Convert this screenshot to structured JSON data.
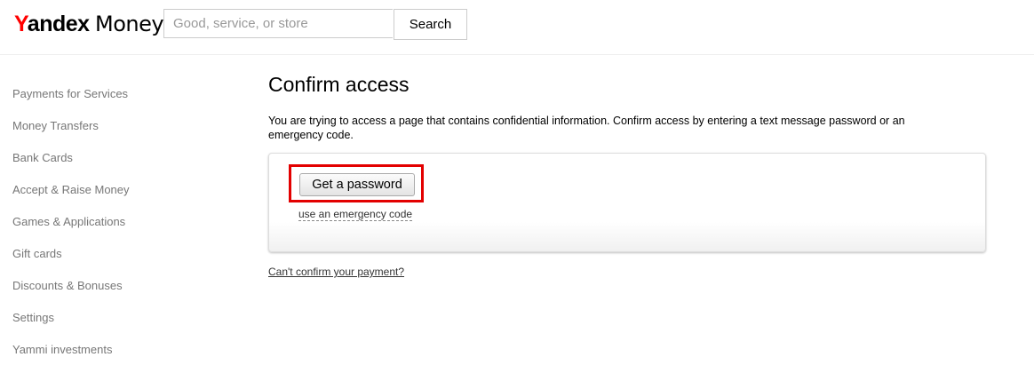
{
  "header": {
    "logo": {
      "brand_first": "Y",
      "brand_rest": "andex",
      "product": "Money"
    },
    "search": {
      "placeholder": "Good, service, or store",
      "value": "",
      "button_label": "Search"
    }
  },
  "sidebar": {
    "items": [
      {
        "label": "Payments for Services"
      },
      {
        "label": "Money Transfers"
      },
      {
        "label": "Bank Cards"
      },
      {
        "label": "Accept & Raise Money"
      },
      {
        "label": "Games & Applications"
      },
      {
        "label": "Gift cards"
      },
      {
        "label": "Discounts & Bonuses"
      },
      {
        "label": "Settings"
      },
      {
        "label": "Yammi investments"
      }
    ]
  },
  "main": {
    "title": "Confirm access",
    "description": "You are trying to access a page that contains confidential information. Confirm access by entering a text message password or an emergency code.",
    "card": {
      "get_password_label": "Get a password",
      "emergency_link": "use an emergency code"
    },
    "cant_confirm_link": "Can't confirm your payment?"
  },
  "colors": {
    "logo_accent": "#ff0000",
    "highlight_border": "#e30000",
    "sidebar_text": "#777777"
  }
}
